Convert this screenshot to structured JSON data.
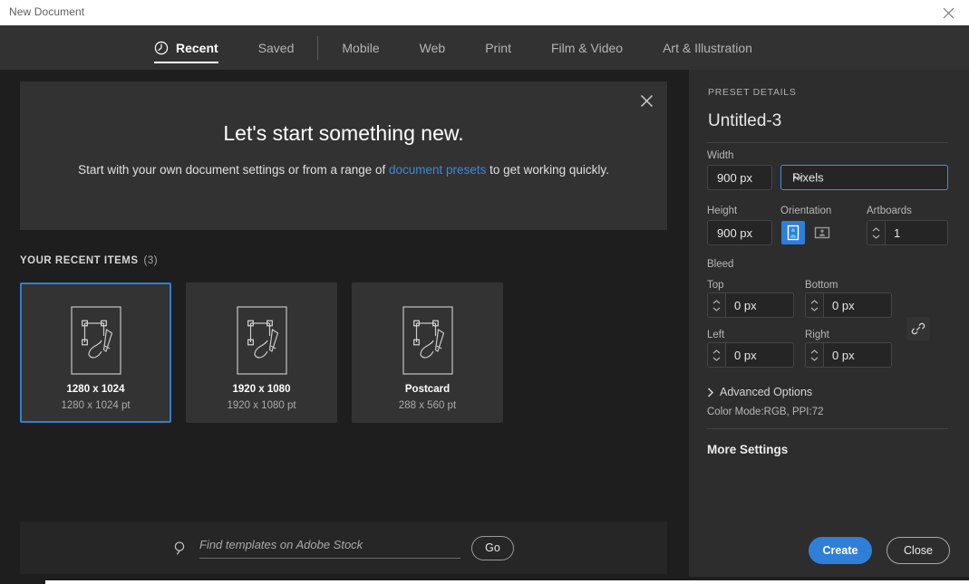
{
  "window": {
    "title": "New Document",
    "close_icon": "close-icon"
  },
  "tabs": [
    {
      "label": "Recent",
      "icon": "clock-icon",
      "active": true
    },
    {
      "label": "Saved",
      "icon": "",
      "active": false
    },
    {
      "label": "Mobile",
      "icon": "",
      "active": false
    },
    {
      "label": "Web",
      "icon": "",
      "active": false
    },
    {
      "label": "Print",
      "icon": "",
      "active": false
    },
    {
      "label": "Film & Video",
      "icon": "",
      "active": false
    },
    {
      "label": "Art & Illustration",
      "icon": "",
      "active": false
    }
  ],
  "banner": {
    "title": "Let's start something new.",
    "text_before": "Start with your own document settings or from a range of ",
    "link": "document presets",
    "text_after": " to get working quickly.",
    "close_icon": "close-icon"
  },
  "recent": {
    "heading": "YOUR RECENT ITEMS",
    "count": "(3)",
    "items": [
      {
        "name": "1280 x 1024",
        "size": "1280 x 1024 pt",
        "selected": true
      },
      {
        "name": "1920 x 1080",
        "size": "1920 x 1080 pt",
        "selected": false
      },
      {
        "name": "Postcard",
        "size": "288 x 560 pt",
        "selected": false
      }
    ]
  },
  "stock": {
    "search_icon": "search-icon",
    "placeholder": "Find templates on Adobe Stock",
    "value": "",
    "go_label": "Go"
  },
  "preset": {
    "section_label": "PRESET DETAILS",
    "name": "Untitled-3",
    "width_label": "Width",
    "width_value": "900 px",
    "units_value": "Pixels",
    "units_chevron": "chevron-down-icon",
    "height_label": "Height",
    "height_value": "900 px",
    "orientation_label": "Orientation",
    "orientation_portrait_icon": "portrait-icon",
    "orientation_landscape_icon": "landscape-icon",
    "artboards_label": "Artboards",
    "artboards_value": "1",
    "bleed_label": "Bleed",
    "bleed_top_label": "Top",
    "bleed_top_value": "0 px",
    "bleed_bottom_label": "Bottom",
    "bleed_bottom_value": "0 px",
    "bleed_left_label": "Left",
    "bleed_left_value": "0 px",
    "bleed_right_label": "Right",
    "bleed_right_value": "0 px",
    "link_icon": "link-icon",
    "advanced_label": "Advanced Options",
    "advanced_chevron": "chevron-right-icon",
    "color_mode": "Color Mode:RGB, PPI:72",
    "more_settings": "More Settings"
  },
  "actions": {
    "create_label": "Create",
    "close_label": "Close"
  },
  "colors": {
    "accent": "#2f7fd8",
    "link": "#3d88d4",
    "titlebar_bg": "#ffffff",
    "tabbar_bg": "#323232",
    "left_bg": "#1e1e1e",
    "right_bg": "#2d2d2d",
    "card_bg": "#333333",
    "banner_bg": "#323232"
  }
}
